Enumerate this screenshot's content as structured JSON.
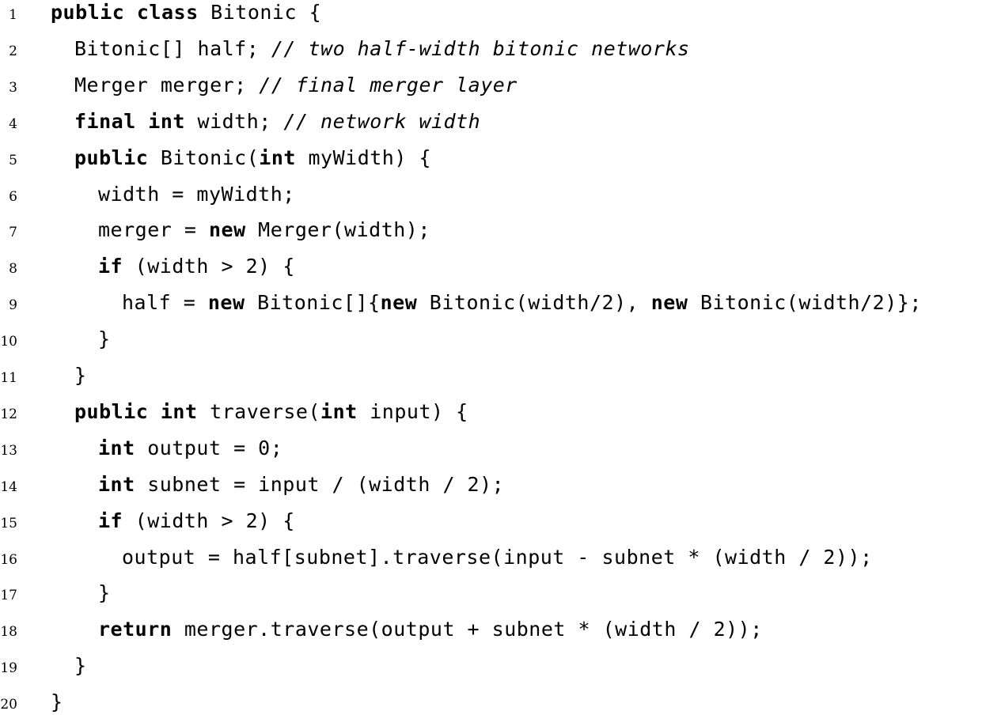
{
  "listing": {
    "lines": [
      {
        "num": "1",
        "indent": 0,
        "tokens": [
          [
            "kw",
            "public class"
          ],
          [
            "t",
            " Bitonic {"
          ]
        ]
      },
      {
        "num": "2",
        "indent": 1,
        "tokens": [
          [
            "t",
            "Bitonic[] half; "
          ],
          [
            "cm",
            "// two half-width bitonic networks"
          ]
        ]
      },
      {
        "num": "3",
        "indent": 1,
        "tokens": [
          [
            "t",
            "Merger merger; "
          ],
          [
            "cm",
            "// final merger layer"
          ]
        ]
      },
      {
        "num": "4",
        "indent": 1,
        "tokens": [
          [
            "kw",
            "final int"
          ],
          [
            "t",
            " width; "
          ],
          [
            "cm",
            "// network width"
          ]
        ]
      },
      {
        "num": "5",
        "indent": 1,
        "tokens": [
          [
            "kw",
            "public"
          ],
          [
            "t",
            " Bitonic("
          ],
          [
            "kw",
            "int"
          ],
          [
            "t",
            " myWidth) {"
          ]
        ]
      },
      {
        "num": "6",
        "indent": 2,
        "tokens": [
          [
            "t",
            "width = myWidth;"
          ]
        ]
      },
      {
        "num": "7",
        "indent": 2,
        "tokens": [
          [
            "t",
            "merger = "
          ],
          [
            "kw",
            "new"
          ],
          [
            "t",
            " Merger(width);"
          ]
        ]
      },
      {
        "num": "8",
        "indent": 2,
        "tokens": [
          [
            "kw",
            "if"
          ],
          [
            "t",
            " (width > 2) {"
          ]
        ]
      },
      {
        "num": "9",
        "indent": 3,
        "tokens": [
          [
            "t",
            "half = "
          ],
          [
            "kw",
            "new"
          ],
          [
            "t",
            " Bitonic[]{"
          ],
          [
            "kw",
            "new"
          ],
          [
            "t",
            " Bitonic(width/2), "
          ],
          [
            "kw",
            "new"
          ],
          [
            "t",
            " Bitonic(width/2)};"
          ]
        ]
      },
      {
        "num": "10",
        "indent": 2,
        "tokens": [
          [
            "t",
            "}"
          ]
        ]
      },
      {
        "num": "11",
        "indent": 1,
        "tokens": [
          [
            "t",
            "}"
          ]
        ]
      },
      {
        "num": "12",
        "indent": 1,
        "tokens": [
          [
            "kw",
            "public int"
          ],
          [
            "t",
            " traverse("
          ],
          [
            "kw",
            "int"
          ],
          [
            "t",
            " input) {"
          ]
        ]
      },
      {
        "num": "13",
        "indent": 2,
        "tokens": [
          [
            "kw",
            "int"
          ],
          [
            "t",
            " output = 0;"
          ]
        ]
      },
      {
        "num": "14",
        "indent": 2,
        "tokens": [
          [
            "kw",
            "int"
          ],
          [
            "t",
            " subnet = input / (width / 2);"
          ]
        ]
      },
      {
        "num": "15",
        "indent": 2,
        "tokens": [
          [
            "kw",
            "if"
          ],
          [
            "t",
            " (width > 2) {"
          ]
        ]
      },
      {
        "num": "16",
        "indent": 3,
        "tokens": [
          [
            "t",
            "output = half[subnet].traverse(input - subnet * (width / 2));"
          ]
        ]
      },
      {
        "num": "17",
        "indent": 2,
        "tokens": [
          [
            "t",
            "}"
          ]
        ]
      },
      {
        "num": "18",
        "indent": 2,
        "tokens": [
          [
            "kw",
            "return"
          ],
          [
            "t",
            " merger.traverse(output + subnet * (width / 2));"
          ]
        ]
      },
      {
        "num": "19",
        "indent": 1,
        "tokens": [
          [
            "t",
            "}"
          ]
        ]
      },
      {
        "num": "20",
        "indent": 0,
        "tokens": [
          [
            "t",
            "}"
          ]
        ]
      }
    ]
  }
}
